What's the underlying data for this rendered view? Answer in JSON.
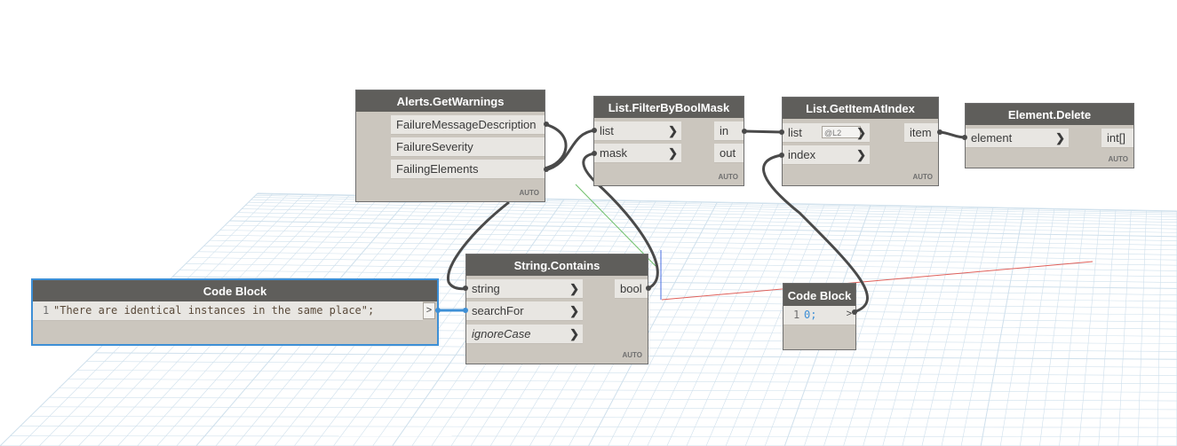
{
  "colors": {
    "node_header": "#5f5e5b",
    "node_body": "#cbc6be",
    "port_bg": "#e8e6e2",
    "wire": "#4a4a4a",
    "selected_border": "#3d8fd6",
    "grid": "#cfe0ec",
    "axis_x": "#e0605a",
    "axis_y": "#6fbf6a",
    "axis_z": "#4a6ee0"
  },
  "auto_label": "AUTO",
  "nodes": {
    "alerts_getwarnings": {
      "title": "Alerts.GetWarnings",
      "outputs": [
        "FailureMessageDescription",
        "FailureSeverity",
        "FailingElements"
      ]
    },
    "list_filterbyboolmask": {
      "title": "List.FilterByBoolMask",
      "inputs": [
        "list",
        "mask"
      ],
      "outputs": [
        "in",
        "out"
      ]
    },
    "list_getitematindex": {
      "title": "List.GetItemAtIndex",
      "inputs": [
        "list",
        "index"
      ],
      "lacing": "@L2",
      "outputs": [
        "item"
      ]
    },
    "element_delete": {
      "title": "Element.Delete",
      "inputs": [
        "element"
      ],
      "outputs": [
        "int[]"
      ]
    },
    "string_contains": {
      "title": "String.Contains",
      "inputs": [
        "string",
        "searchFor",
        "ignoreCase"
      ],
      "outputs": [
        "bool"
      ]
    },
    "code_block_1": {
      "title": "Code Block",
      "line_number": "1",
      "code": "\"There are identical instances in the same place\";",
      "output_glyph": ">"
    },
    "code_block_2": {
      "title": "Code Block",
      "line_number": "1",
      "code": "0;",
      "output_glyph": ">"
    }
  }
}
